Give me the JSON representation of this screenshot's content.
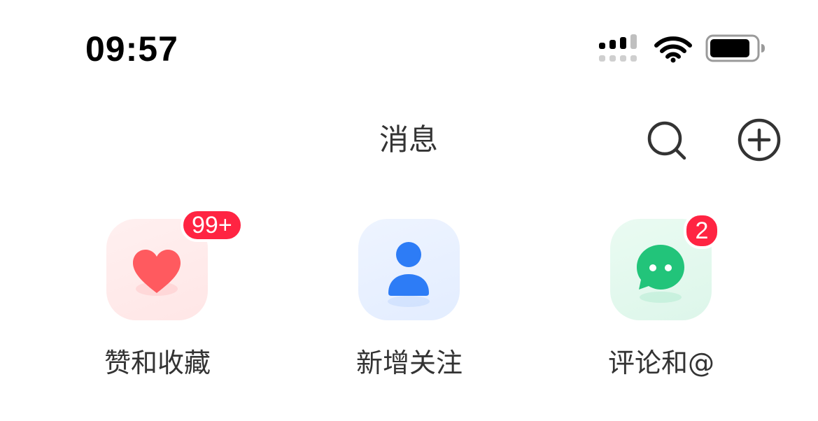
{
  "status_bar": {
    "time": "09:57",
    "signal_icon": "cellular-signal-icon",
    "wifi_icon": "wifi-icon",
    "battery_icon": "battery-icon"
  },
  "header": {
    "title": "消息",
    "search_icon": "search-icon",
    "add_icon": "plus-circle-icon"
  },
  "shortcuts": [
    {
      "label": "赞和收藏",
      "badge": "99+",
      "icon": "heart-icon",
      "color": "#ff5a5f"
    },
    {
      "label": "新增关注",
      "badge": "",
      "icon": "person-icon",
      "color": "#2d7cf6"
    },
    {
      "label": "评论和@",
      "badge": "2",
      "icon": "chat-bubble-icon",
      "color": "#22c47a"
    }
  ],
  "colors": {
    "badge": "#ff2442",
    "text": "#333333"
  }
}
